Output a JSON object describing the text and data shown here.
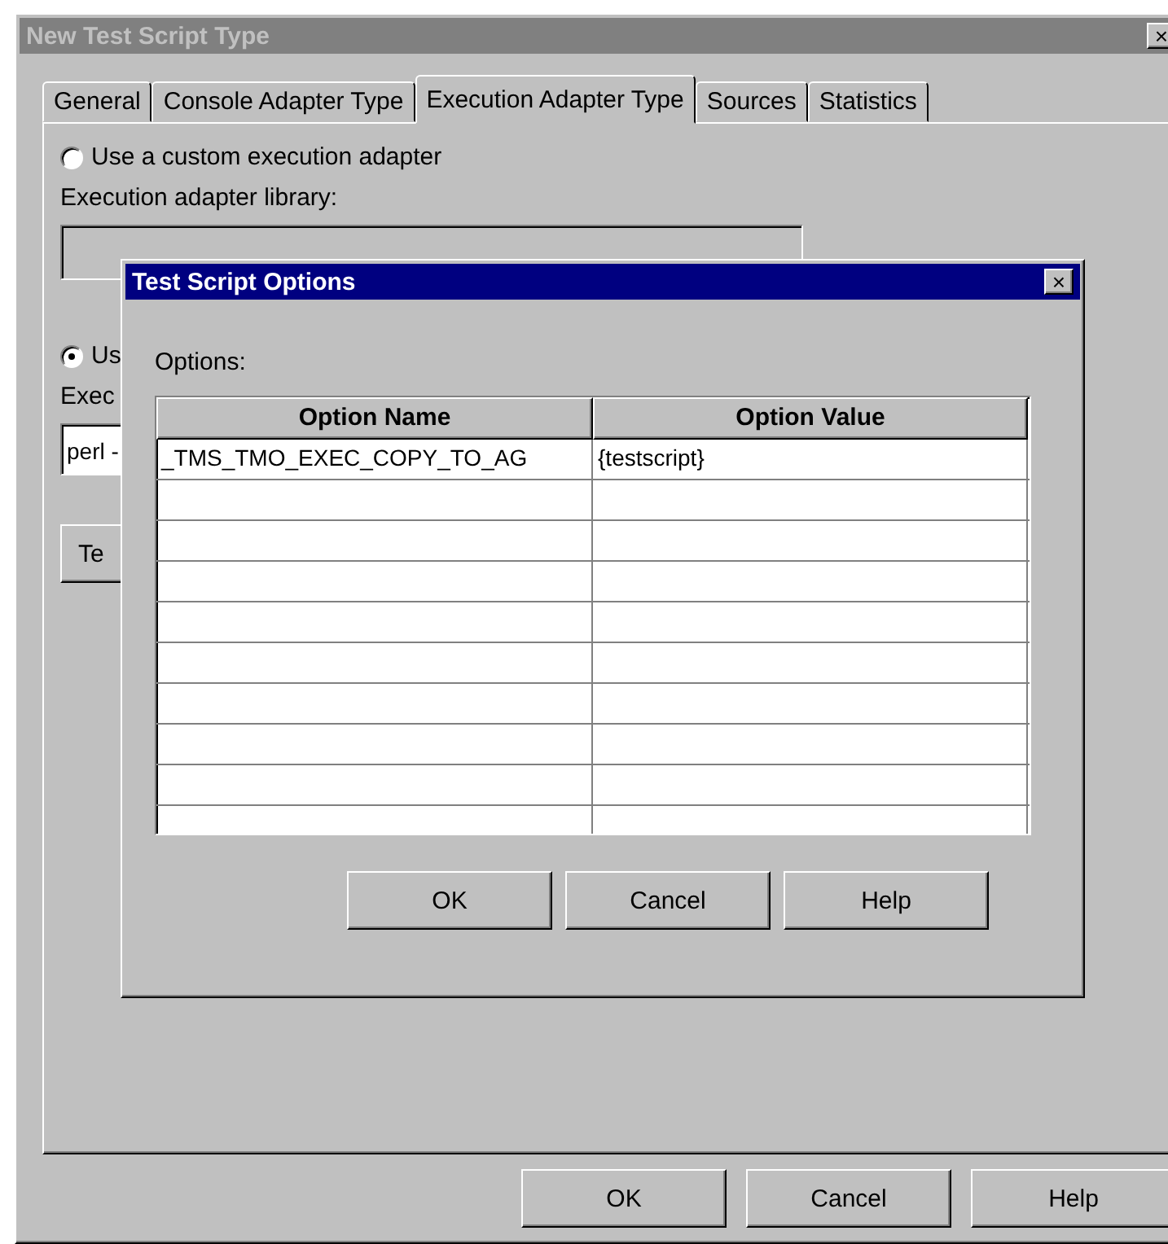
{
  "window": {
    "title": "New Test Script Type",
    "close": "×"
  },
  "tabs": [
    {
      "label": "General",
      "selected": false
    },
    {
      "label": "Console Adapter Type",
      "selected": false
    },
    {
      "label": "Execution Adapter Type",
      "selected": true
    },
    {
      "label": "Sources",
      "selected": false
    },
    {
      "label": "Statistics",
      "selected": false
    }
  ],
  "custom_radio": {
    "label": "Use a custom execution adapter",
    "selected": false
  },
  "library_label": "Execution adapter library:",
  "other_radio": {
    "label": "Us",
    "selected": true
  },
  "exec_label": "Exec",
  "exec_field": {
    "value": "perl -"
  },
  "test_button": "Te",
  "buttons": [
    "OK",
    "Cancel",
    "Help"
  ],
  "dialog": {
    "title": "Test Script Options",
    "close": "×",
    "options_label": "Options:",
    "columns": [
      "Option Name",
      "Option Value"
    ],
    "rows": [
      [
        "_TMS_TMO_EXEC_COPY_TO_AG",
        "{testscript}"
      ]
    ],
    "buttons": [
      "OK",
      "Cancel",
      "Help"
    ]
  }
}
